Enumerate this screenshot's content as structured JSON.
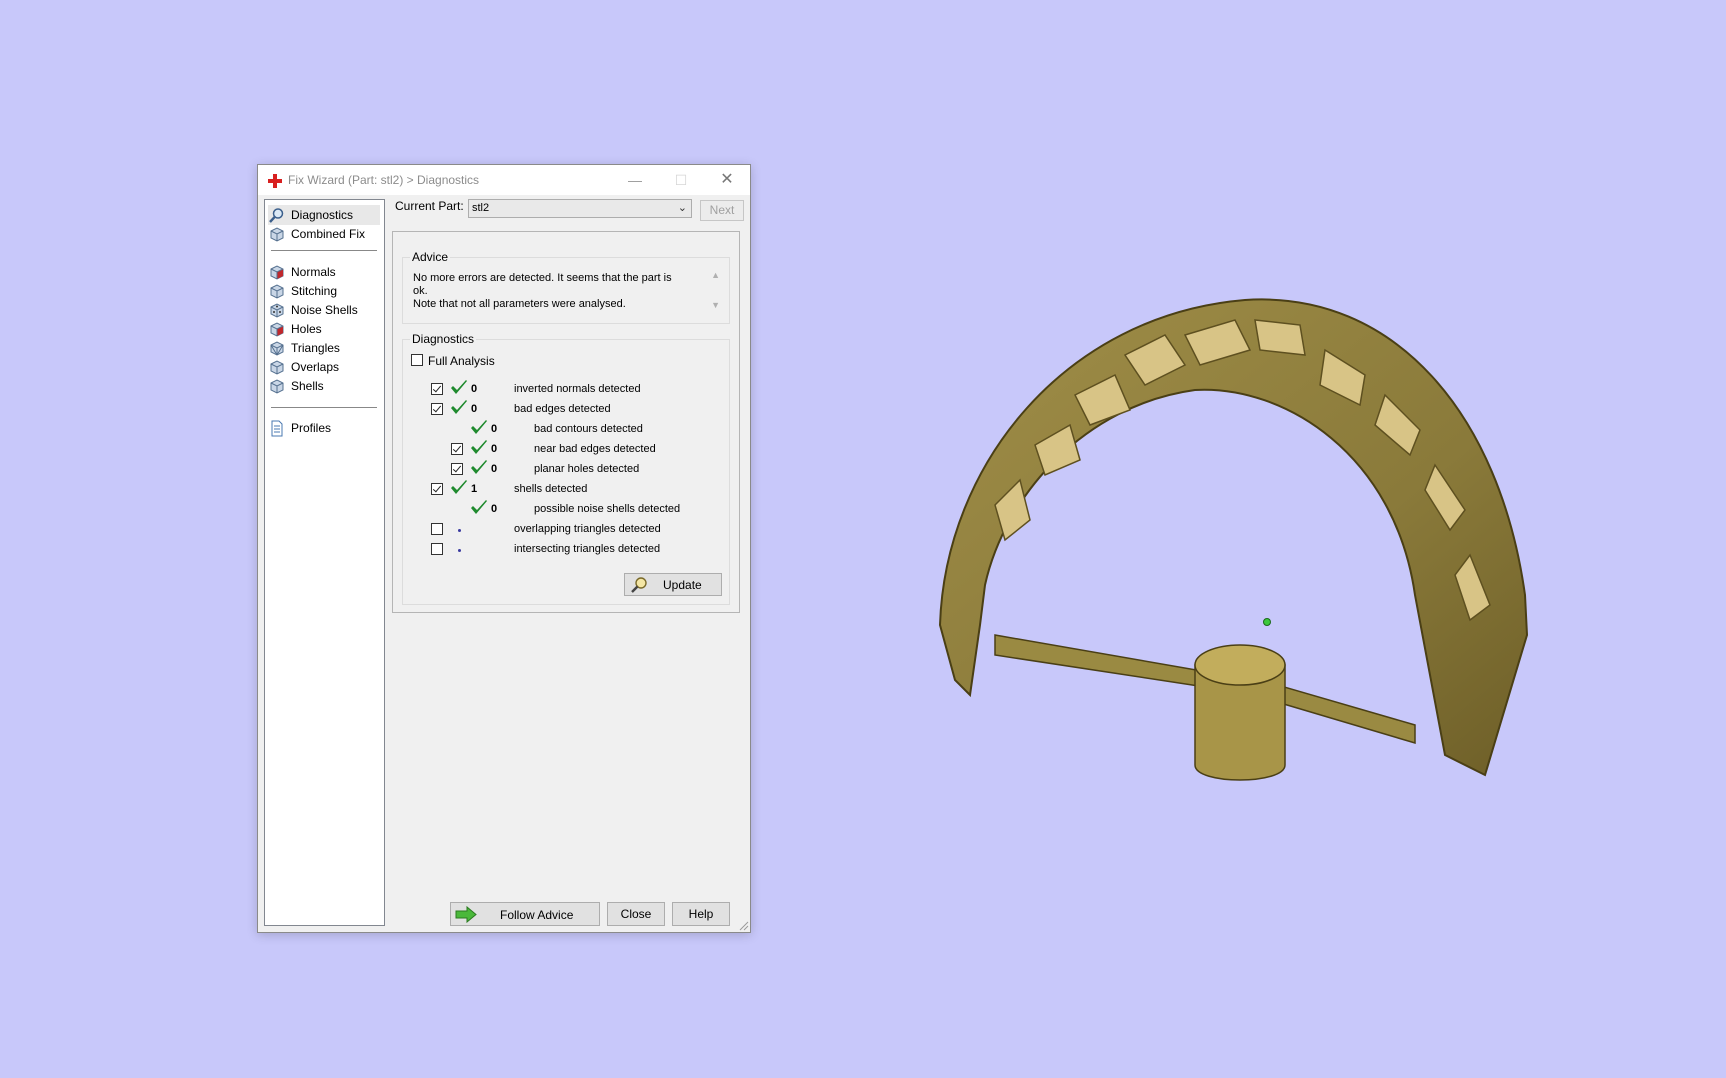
{
  "window": {
    "title": "Fix Wizard (Part: stl2) > Diagnostics"
  },
  "nav": {
    "items": [
      {
        "label": "Diagnostics",
        "icon": "diagnostics-magnifier-icon",
        "selected": true
      },
      {
        "label": "Combined Fix",
        "icon": "combined-fix-cube-icon"
      },
      {
        "label": "Normals",
        "icon": "normals-cube-icon"
      },
      {
        "label": "Stitching",
        "icon": "stitching-cube-icon"
      },
      {
        "label": "Noise Shells",
        "icon": "noise-shells-dice-icon"
      },
      {
        "label": "Holes",
        "icon": "holes-cube-icon"
      },
      {
        "label": "Triangles",
        "icon": "triangles-cube-icon"
      },
      {
        "label": "Overlaps",
        "icon": "overlaps-cube-icon"
      },
      {
        "label": "Shells",
        "icon": "shells-cube-icon"
      },
      {
        "label": "Profiles",
        "icon": "profiles-document-icon"
      }
    ]
  },
  "current_part": {
    "label": "Current Part:",
    "value": "stl2"
  },
  "next_button": "Next",
  "advice": {
    "title": "Advice",
    "line1": "No more errors are detected. It seems that the part is ok.",
    "line2": "Note that not all parameters were analysed."
  },
  "diagnostics": {
    "title": "Diagnostics",
    "full_analysis_label": "Full Analysis",
    "full_analysis_checked": false,
    "rows": [
      {
        "count": "0",
        "label": "inverted normals detected",
        "checked": true,
        "status": "ok"
      },
      {
        "count": "0",
        "label": "bad edges detected",
        "checked": true,
        "status": "ok"
      },
      {
        "count": "0",
        "label": "bad contours detected",
        "status": "ok"
      },
      {
        "count": "0",
        "label": "near bad edges detected",
        "checked": true,
        "status": "ok"
      },
      {
        "count": "0",
        "label": "planar holes detected",
        "checked": true,
        "status": "ok"
      },
      {
        "count": "1",
        "label": "shells detected",
        "checked": true,
        "status": "ok"
      },
      {
        "count": "0",
        "label": "possible noise shells detected",
        "status": "ok"
      },
      {
        "label": "overlapping triangles detected",
        "checked": false,
        "status": "not-analysed"
      },
      {
        "label": "intersecting triangles detected",
        "checked": false,
        "status": "not-analysed"
      }
    ],
    "update_button": "Update"
  },
  "footer": {
    "follow_advice": "Follow Advice",
    "close": "Close",
    "help": "Help"
  },
  "colors": {
    "viewport_background": "#c8c8fa",
    "model": "#8a7a3a",
    "check_green": "#1f8a2e"
  }
}
